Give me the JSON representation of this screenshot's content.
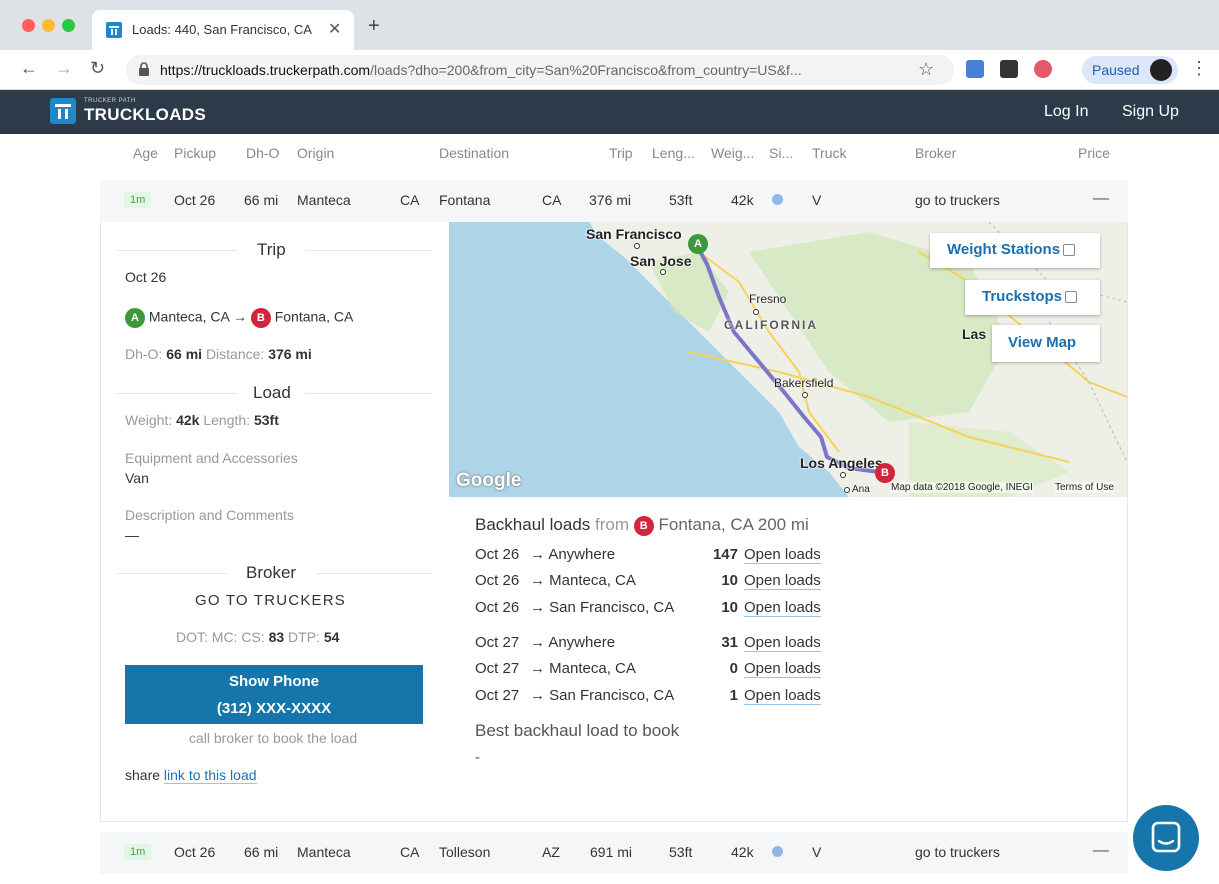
{
  "browser": {
    "tab_title": "Loads: 440, San Francisco, CA",
    "url_host": "https://truckloads.truckerpath.com",
    "url_path": "/loads?dho=200&from_city=San%20Francisco&from_country=US&f...",
    "paused_label": "Paused"
  },
  "site": {
    "logo_small": "TRUCKER PATH",
    "logo_main": "TRUCKLOADS",
    "login": "Log In",
    "signup": "Sign Up"
  },
  "table": {
    "headers": [
      "Age",
      "Pickup",
      "Dh-O",
      "Origin",
      "Destination",
      "Trip",
      "Leng...",
      "Weig...",
      "Si...",
      "Truck",
      "Broker",
      "Price"
    ],
    "rows": [
      {
        "age": "1m",
        "pickup": "Oct 26",
        "dho": "66 mi",
        "origin": "Manteca",
        "origin_state": "CA",
        "dest": "Fontana",
        "dest_state": "CA",
        "trip": "376 mi",
        "length": "53ft",
        "weight": "42k",
        "truck": "V",
        "broker": "go to truckers",
        "price": "—"
      },
      {
        "age": "1m",
        "pickup": "Oct 26",
        "dho": "66 mi",
        "origin": "Manteca",
        "origin_state": "CA",
        "dest": "Tolleson",
        "dest_state": "AZ",
        "trip": "691 mi",
        "length": "53ft",
        "weight": "42k",
        "truck": "V",
        "broker": "go to truckers",
        "price": "—"
      }
    ]
  },
  "detail": {
    "trip_title": "Trip",
    "trip_date": "Oct 26",
    "origin": "Manteca, CA",
    "arrow": "→",
    "dest": "Fontana, CA",
    "pin_a": "A",
    "pin_b": "B",
    "dho_label": "Dh-O:",
    "dho_value": "66 mi",
    "distance_label": "Distance:",
    "distance_value": "376 mi",
    "load_title": "Load",
    "weight_label": "Weight:",
    "weight_value": "42k",
    "length_label": "Length:",
    "length_value": "53ft",
    "equipment_label": "Equipment and Accessories",
    "equipment_value": "Van",
    "description_label": "Description and Comments",
    "description_value": "—",
    "broker_title": "Broker",
    "broker_name": "GO TO TRUCKERS",
    "dot_label": "DOT:",
    "mc_label": "MC:",
    "cs_label": "CS:",
    "cs_value": "83",
    "dtp_label": "DTP:",
    "dtp_value": "54",
    "show_phone": "Show Phone",
    "phone": "(312) XXX-XXXX",
    "call_note": "call broker to book the load",
    "share_label": "share",
    "share_link": "link to this load"
  },
  "map": {
    "weight_stations": "Weight Stations",
    "truckstops": "Truckstops",
    "view_map": "View Map",
    "cities": {
      "sf": "San Francisco",
      "sj": "San Jose",
      "fresno": "Fresno",
      "california": "CALIFORNIA",
      "las": "Las",
      "bakersfield": "Bakersfield",
      "la": "Los Angeles",
      "ana": "Ana"
    },
    "google": "Google",
    "map_data": "Map data ©2018 Google, INEGI",
    "terms": "Terms of Use"
  },
  "backhaul": {
    "title_prefix": "Backhaul loads",
    "from_label": "from",
    "city": "Fontana, CA",
    "radius": "200 mi",
    "rows": [
      {
        "date": "Oct 26",
        "dest": "→ Anywhere",
        "count": "147",
        "link": "Open loads"
      },
      {
        "date": "Oct 26",
        "dest": "→ Manteca, CA",
        "count": "10",
        "link": "Open loads"
      },
      {
        "date": "Oct 26",
        "dest": "→ San Francisco, CA",
        "count": "10",
        "link": "Open loads"
      },
      {
        "date": "Oct 27",
        "dest": "→ Anywhere",
        "count": "31",
        "link": "Open loads"
      },
      {
        "date": "Oct 27",
        "dest": "→ Manteca, CA",
        "count": "0",
        "link": "Open loads"
      },
      {
        "date": "Oct 27",
        "dest": "→ San Francisco, CA",
        "count": "1",
        "link": "Open loads"
      }
    ],
    "best_title": "Best backhaul load to book",
    "best_value": "-"
  },
  "colors": {
    "header_bg": "#2c3a4a",
    "brand_blue": "#1675ab",
    "pin_a": "#3c9a3c",
    "pin_b": "#d0253a",
    "route": "#7b76c9"
  }
}
